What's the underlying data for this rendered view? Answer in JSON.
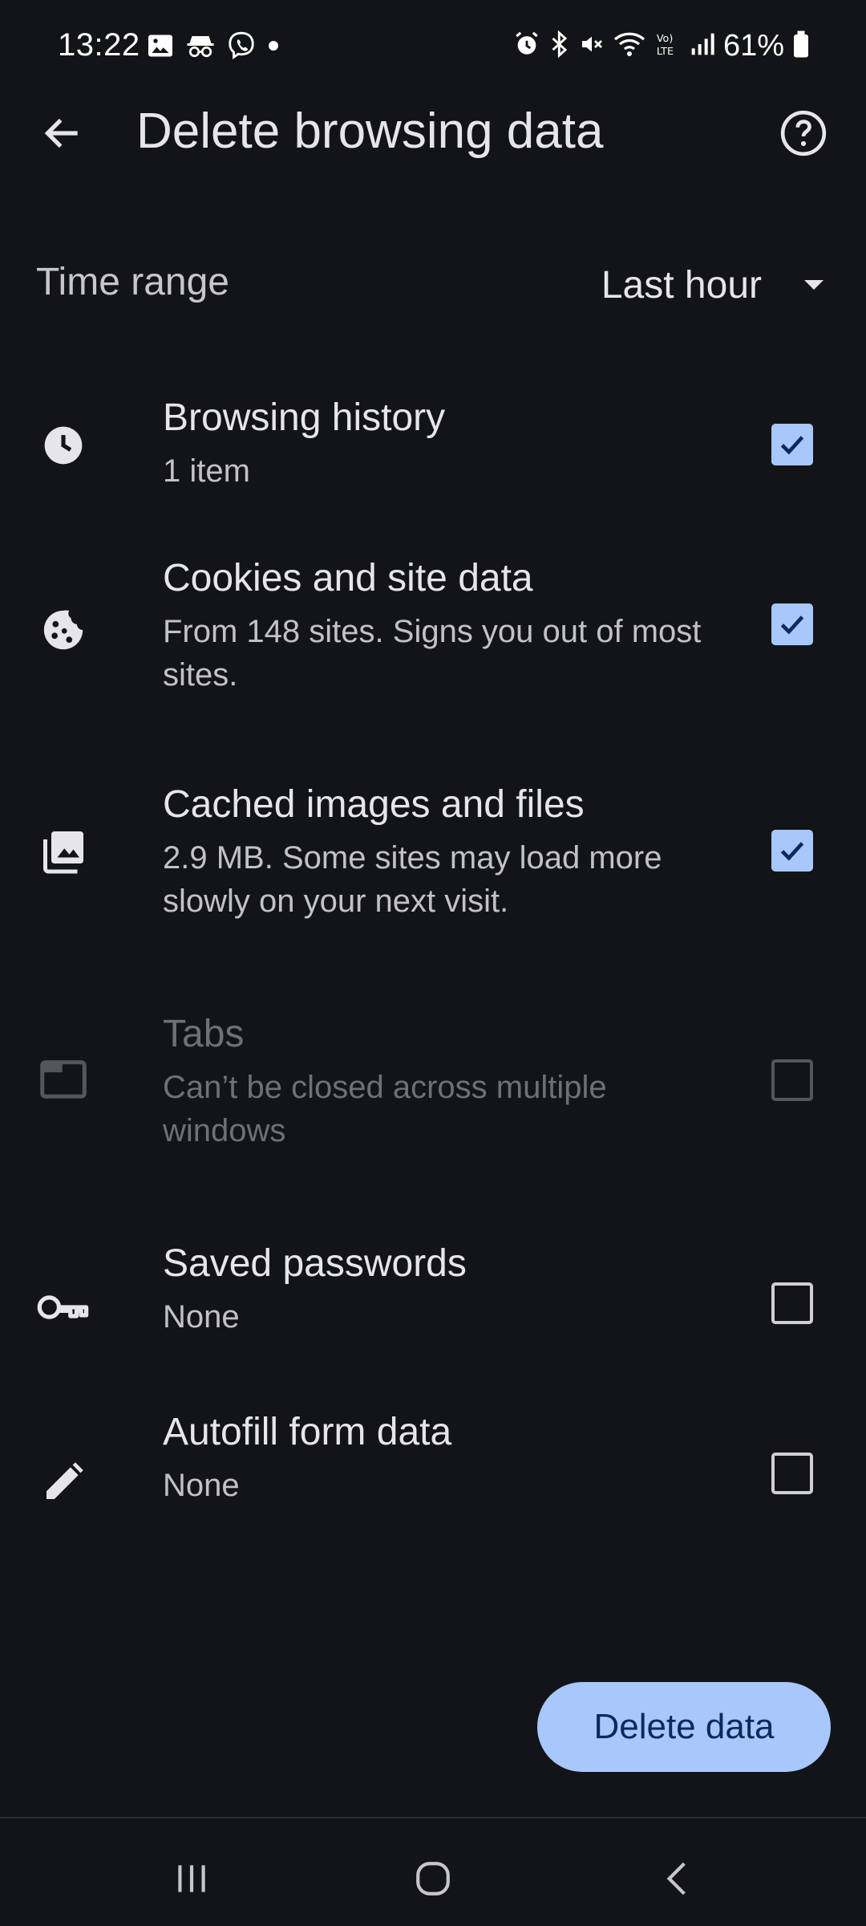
{
  "status_bar": {
    "time": "13:22",
    "battery": "61%",
    "left_icons": [
      "gallery-icon",
      "incognito-icon",
      "viber-icon",
      "dot-icon"
    ],
    "right_icons": [
      "alarm-icon",
      "bluetooth-icon",
      "mute-icon",
      "wifi-icon",
      "volte-icon",
      "signal-icon",
      "battery-icon"
    ]
  },
  "header": {
    "title": "Delete browsing data",
    "back_icon": "back-arrow-icon",
    "help_icon": "help-icon"
  },
  "time_range": {
    "label": "Time range",
    "value": "Last hour",
    "dropdown_icon": "dropdown-arrow-icon"
  },
  "options": [
    {
      "title": "Browsing history",
      "desc": "1 item",
      "icon": "clock-icon",
      "checked": true,
      "disabled": false
    },
    {
      "title": "Cookies and site data",
      "desc": "From 148 sites. Signs you out of most sites.",
      "icon": "cookie-icon",
      "checked": true,
      "disabled": false
    },
    {
      "title": "Cached images and files",
      "desc": "2.9 MB. Some sites may load more slowly on your next visit.",
      "icon": "images-icon",
      "checked": true,
      "disabled": false
    },
    {
      "title": "Tabs",
      "desc": "Can’t be closed across multiple windows",
      "icon": "tab-icon",
      "checked": false,
      "disabled": true
    },
    {
      "title": "Saved passwords",
      "desc": "None",
      "icon": "key-icon",
      "checked": false,
      "disabled": false
    },
    {
      "title": "Autofill form data",
      "desc": "None",
      "icon": "pencil-icon",
      "checked": false,
      "disabled": false
    }
  ],
  "actions": {
    "delete_label": "Delete data"
  },
  "nav": {
    "recents_icon": "recents-icon",
    "home_icon": "home-icon",
    "back_icon": "nav-back-icon"
  },
  "colors": {
    "background": "#131418",
    "accent": "#a8c7fa",
    "accent_text": "#0a2a5c",
    "disabled": "#6f7075"
  }
}
